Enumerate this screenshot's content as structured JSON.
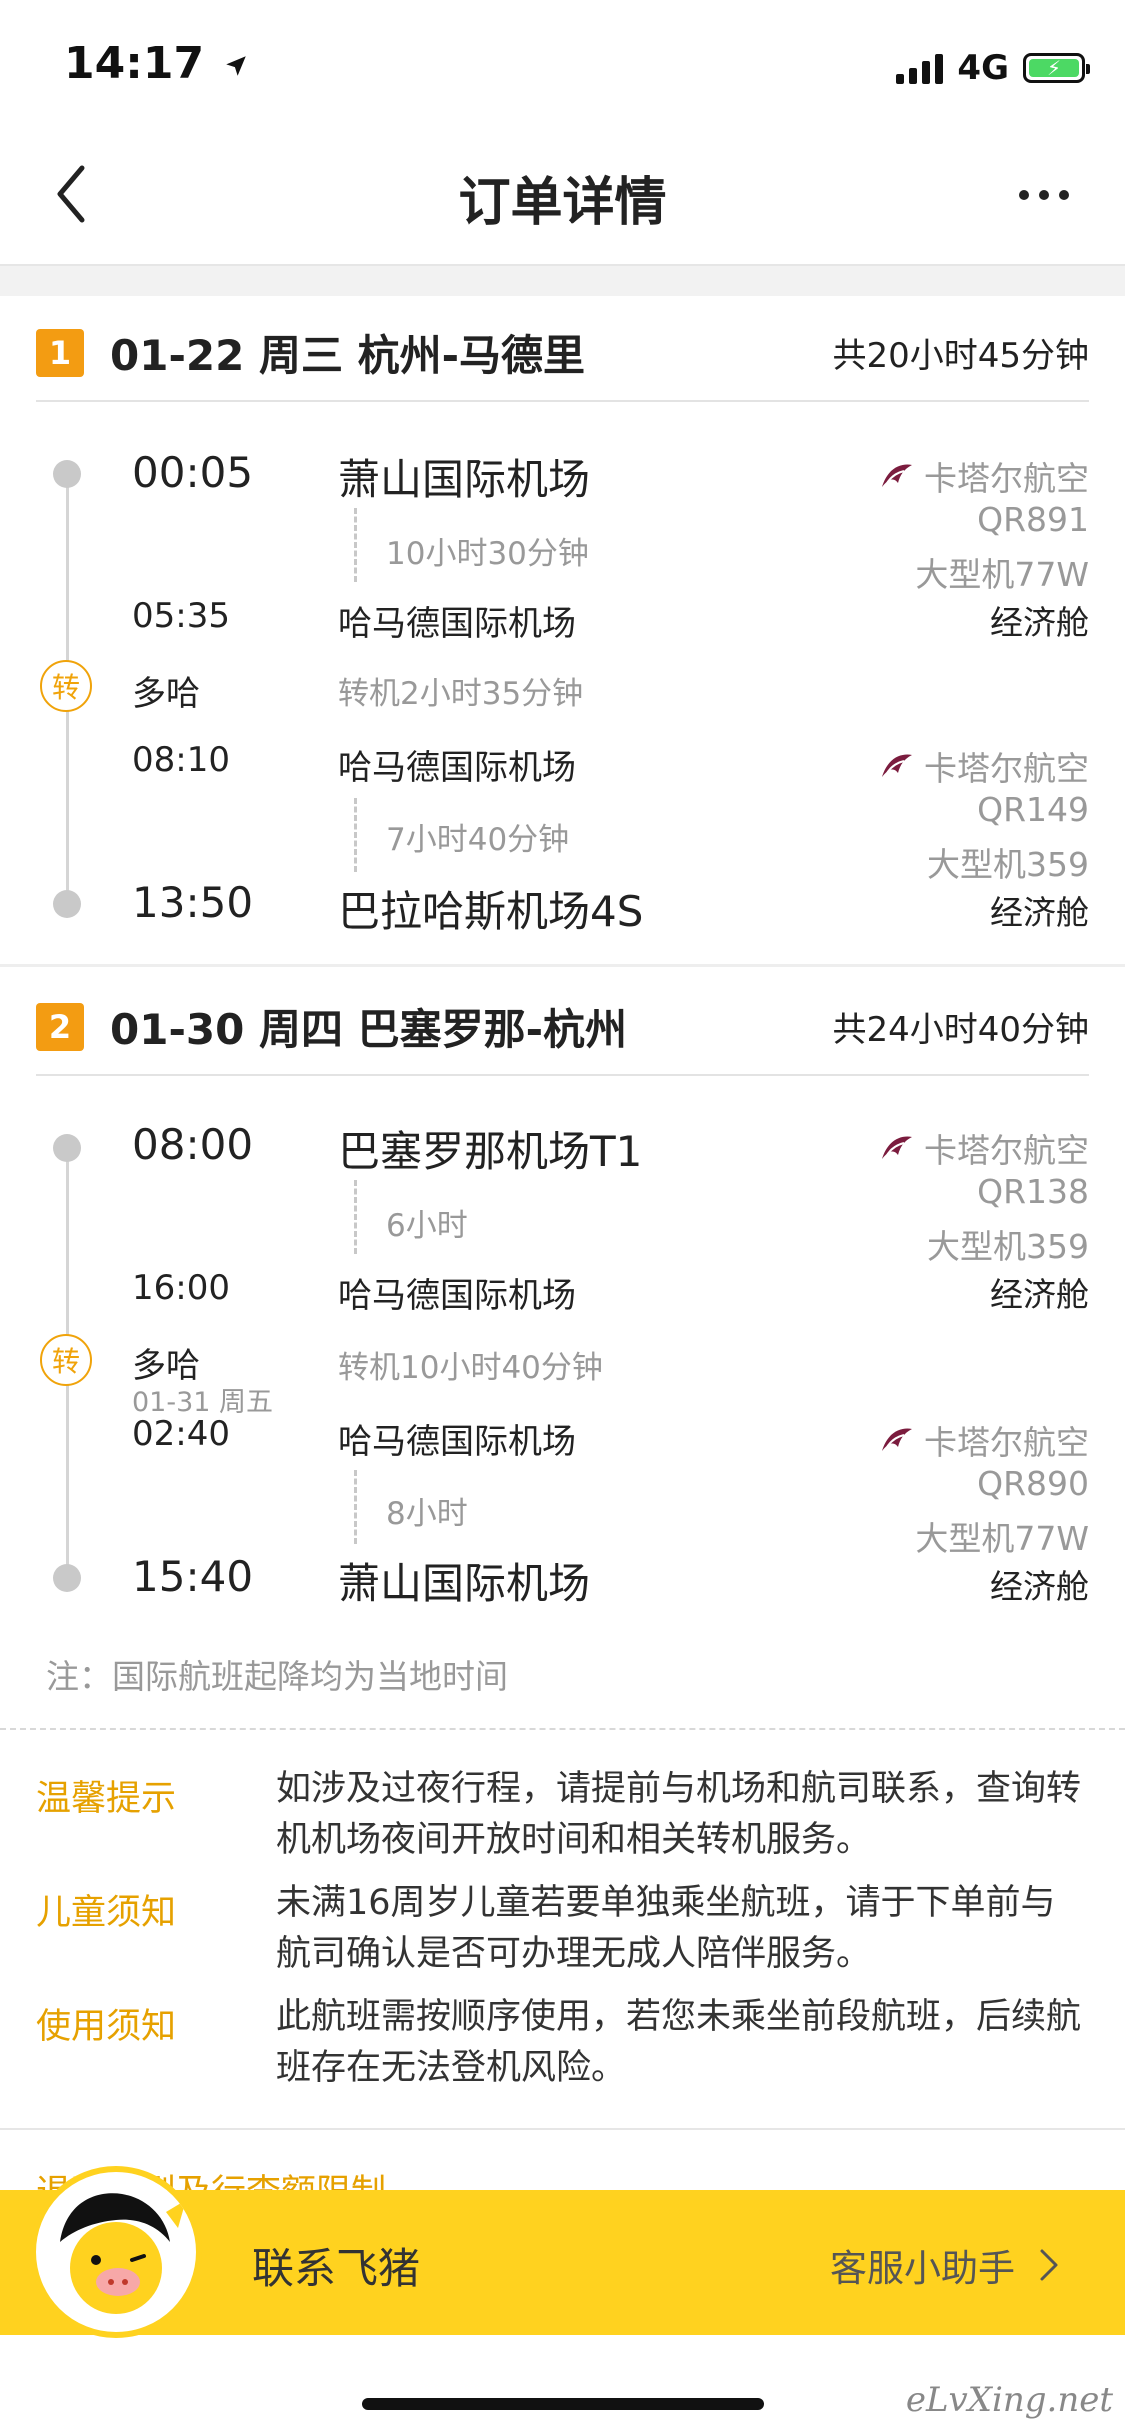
{
  "status_bar": {
    "time": "14:17",
    "network": "4G"
  },
  "nav": {
    "title": "订单详情"
  },
  "segments": [
    {
      "index": "1",
      "title": "01-22 周三 杭州-马德里",
      "total_duration": "共20小时45分钟",
      "legs": [
        {
          "dep_time": "00:05",
          "dep_airport": "萧山国际机场",
          "duration": "10小时30分钟",
          "arr_time": "05:35",
          "arr_airport": "哈马德国际机场",
          "airline": "卡塔尔航空",
          "flight_no": "QR891",
          "aircraft": "大型机77W",
          "cabin": "经济舱"
        },
        {
          "dep_time": "08:10",
          "dep_airport": "哈马德国际机场",
          "duration": "7小时40分钟",
          "arr_time": "13:50",
          "arr_airport": "巴拉哈斯机场4S",
          "airline": "卡塔尔航空",
          "flight_no": "QR149",
          "aircraft": "大型机359",
          "cabin": "经济舱"
        }
      ],
      "transfer": {
        "icon_label": "转",
        "city": "多哈",
        "info": "转机2小时35分钟",
        "date_note": ""
      }
    },
    {
      "index": "2",
      "title": "01-30 周四 巴塞罗那-杭州",
      "total_duration": "共24小时40分钟",
      "legs": [
        {
          "dep_time": "08:00",
          "dep_airport": "巴塞罗那机场T1",
          "duration": "6小时",
          "arr_time": "16:00",
          "arr_airport": "哈马德国际机场",
          "airline": "卡塔尔航空",
          "flight_no": "QR138",
          "aircraft": "大型机359",
          "cabin": "经济舱"
        },
        {
          "dep_time": "02:40",
          "dep_airport": "哈马德国际机场",
          "duration": "8小时",
          "arr_time": "15:40",
          "arr_airport": "萧山国际机场",
          "airline": "卡塔尔航空",
          "flight_no": "QR890",
          "aircraft": "大型机77W",
          "cabin": "经济舱"
        }
      ],
      "transfer": {
        "icon_label": "转",
        "city": "多哈",
        "info": "转机10小时40分钟",
        "date_note": "01-31 周五"
      }
    }
  ],
  "note": "注：国际航班起降均为当地时间",
  "tips": [
    {
      "label": "温馨提示",
      "text": "如涉及过夜行程，请提前与机场和航司联系，查询转机机场夜间开放时间和相关转机服务。"
    },
    {
      "label": "儿童须知",
      "text": "未满16周岁儿童若要单独乘坐航班，请于下单前与航司确认是否可办理无成人陪伴服务。"
    },
    {
      "label": "使用须知",
      "text": "此航班需按顺序使用，若您未乘坐前段航班，后续航班存在无法登机风险。"
    }
  ],
  "partial_link": "退改规则及行李额限制",
  "contact": {
    "label": "联系飞猪",
    "assistant": "客服小助手"
  },
  "watermark": "eLvXing.net",
  "colors": {
    "accent": "#f39c12",
    "bar": "#ffd21f",
    "tip_label": "#e6a100"
  },
  "icons": [
    "back-arrow-icon",
    "more-icon",
    "location-arrow-icon",
    "signal-icon",
    "battery-icon",
    "qatar-airways-logo-icon",
    "chevron-right-icon",
    "mascot-avatar-icon"
  ]
}
